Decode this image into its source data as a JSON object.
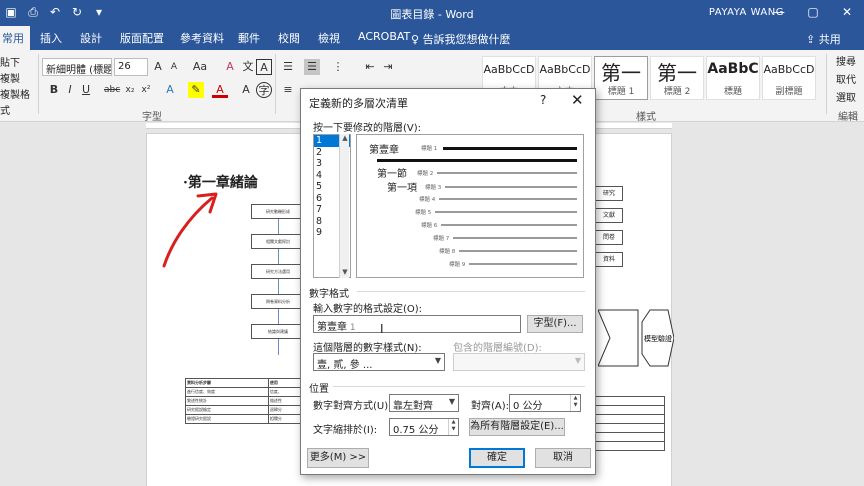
{
  "titlebar": {
    "title": "圖表目錄 - Word",
    "user": "PAYAYA WANG",
    "minimize": "—",
    "restore": "▢",
    "close": "✕"
  },
  "tabs": {
    "home": "常用",
    "insert": "插入",
    "design": "設計",
    "layout": "版面配置",
    "references": "參考資料",
    "mailings": "郵件",
    "review": "校閱",
    "view": "檢視",
    "acrobat": "ACROBAT",
    "tell_me": "告訴我您想做什麼",
    "share": "共用"
  },
  "ribbon": {
    "clipboard": [
      "貼下",
      "複製",
      "複製格式"
    ],
    "font_name": "新細明體 (標題",
    "font_size": "26",
    "font_group_label": "字型",
    "styles_group_label": "樣式",
    "styles": [
      {
        "sample": "AaBbCcD",
        "name": "中文"
      },
      {
        "sample": "AaBbCcD",
        "name": "內文"
      },
      {
        "sample": "第一",
        "name": "標題 1"
      },
      {
        "sample": "第一",
        "name": "標題 2"
      },
      {
        "sample": "AaBbC",
        "name": "標題"
      },
      {
        "sample": "AaBbCcD",
        "name": "副標題"
      }
    ],
    "right_tools": [
      "搜尋",
      "取代",
      "選取"
    ],
    "right_label": "編輯"
  },
  "document": {
    "heading": "·第一章緒論",
    "flow_boxes": [
      "研究動機形成",
      "相關文獻探討",
      "研究方法選用",
      "問卷資料分析",
      "結論與建議"
    ],
    "table_rows": [
      [
        "資料分析步驟",
        "使用"
      ],
      [
        "進行信度、效度",
        "信度、"
      ],
      [
        "敘述性統計",
        "描述性"
      ],
      [
        "研究假說檢定",
        "迴歸分"
      ],
      [
        "驗證研究假設",
        "相關分"
      ]
    ],
    "right_boxes": [
      "研究",
      "文獻",
      "問卷",
      "資料"
    ],
    "hex_label": "模型驗證"
  },
  "dialog": {
    "title": "定義新的多層次清單",
    "help": "?",
    "close": "✕",
    "level_prompt": "按一下要修改的階層(V):",
    "levels": [
      "1",
      "2",
      "3",
      "4",
      "5",
      "6",
      "7",
      "8",
      "9"
    ],
    "preview": {
      "chapter": "第壹章",
      "section": "第一節",
      "item": "第一項",
      "tags": [
        "標題 1",
        "標題 2",
        "標題 3",
        "標題 4",
        "標題 5",
        "標題 6",
        "標題 7",
        "標題 8",
        "標題 9"
      ]
    },
    "number_format_group": "數字格式",
    "enter_format_label": "輸入數字的格式設定(O):",
    "format_value": "第壹章",
    "font_button": "字型(F)...",
    "number_style_label": "這個階層的數字樣式(N):",
    "number_style_value": "壹, 貳, 參 ...",
    "include_level_label": "包含的階層編號(D):",
    "include_level_value": "",
    "position_group": "位置",
    "alignment_label": "數字對齊方式(U):",
    "alignment_value": "靠左對齊",
    "align_at_label": "對齊(A):",
    "align_at_value": "0 公分",
    "indent_label": "文字縮排於(I):",
    "indent_value": "0.75 公分",
    "set_all_button": "為所有階層設定(E)...",
    "more_button": "更多(M) >>",
    "ok_button": "確定",
    "cancel_button": "取消"
  },
  "colors": {
    "word_blue": "#2b579a",
    "selection_blue": "#0078d7",
    "annotation_red": "#d8201f"
  }
}
